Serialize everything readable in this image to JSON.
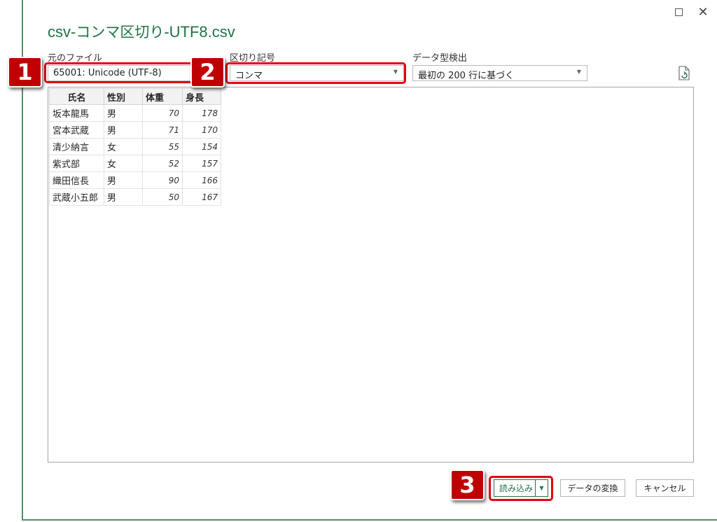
{
  "window": {
    "title_prefix": "csv-",
    "title_middle": "コンマ区切り",
    "title_suffix": "-UTF8.csv",
    "maximize_symbol": "",
    "close_symbol": "✕"
  },
  "file_origin": {
    "label": "元のファイル",
    "value": "65001: Unicode (UTF-8)"
  },
  "delimiter": {
    "label": "区切り記号",
    "value": "コンマ"
  },
  "type_detection": {
    "label": "データ型検出",
    "value": "最初の 200 行に基づく"
  },
  "table": {
    "headers": [
      "氏名",
      "性別",
      "体重",
      "身長"
    ],
    "rows": [
      [
        "坂本龍馬",
        "男",
        "70",
        "178"
      ],
      [
        "宮本武蔵",
        "男",
        "71",
        "170"
      ],
      [
        "清少納言",
        "女",
        "55",
        "154"
      ],
      [
        "紫式部",
        "女",
        "52",
        "157"
      ],
      [
        "織田信長",
        "男",
        "90",
        "166"
      ],
      [
        "武蔵小五郎",
        "男",
        "50",
        "167"
      ]
    ]
  },
  "buttons": {
    "load": "読み込み",
    "transform": "データの変換",
    "cancel": "キャンセル"
  },
  "badges": [
    "1",
    "2",
    "3"
  ],
  "colors": {
    "accent": "#217346",
    "highlight": "#e60012",
    "badge": "#c00000"
  }
}
